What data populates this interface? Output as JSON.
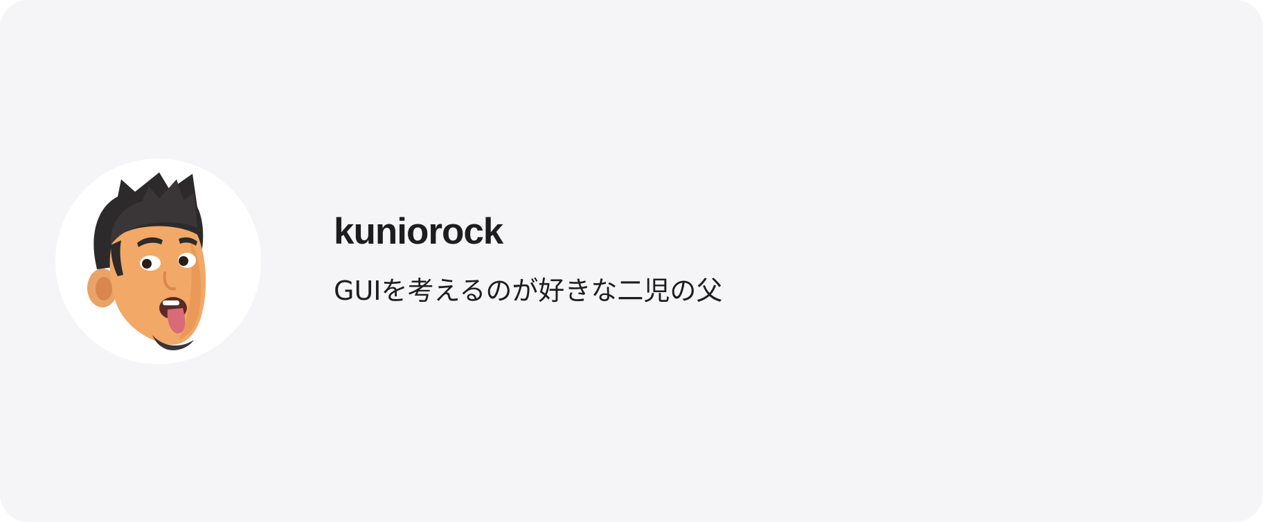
{
  "profile": {
    "username": "kuniorock",
    "bio": "GUIを考えるのが好きな二児の父",
    "avatar_icon": "memoji-avatar-icon"
  },
  "colors": {
    "card_background": "#f5f5f7",
    "avatar_background": "#ffffff",
    "text": "#1d1d1f"
  }
}
